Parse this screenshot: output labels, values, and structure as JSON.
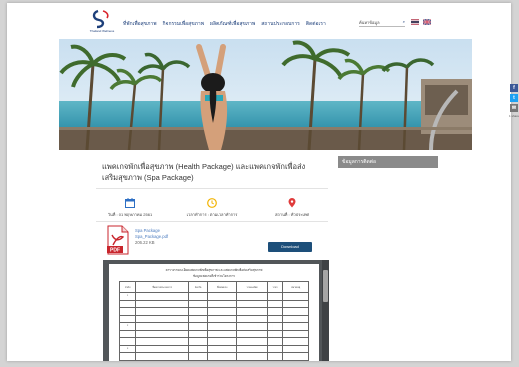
{
  "header": {
    "logo_text": "Thailand Wellness",
    "nav": [
      "ที่พักเพื่อสุขภาพ",
      "กิจกรรมเพื่อสุขภาพ",
      "ผลิตภัณฑ์เพื่อสุขภาพ",
      "สถานประกอบการ",
      "ติดต่อเรา"
    ],
    "search_placeholder": "ค้นหาข้อมูล",
    "flags": [
      "thai-flag-icon",
      "uk-flag-icon"
    ]
  },
  "article": {
    "title": "แพคเกจพักเพื่อสุขภาพ (Health Package) และแพคเกจพักเพื่อส่งเสริมสุขภาพ (Spa Package)",
    "date_label": "วันที่ : 01 พฤษภาคม 2561",
    "hours_label": "เวลาทำการ : ตามเวลาทำการ",
    "location_label": "สถานที่ : ทั่วประเทศ",
    "file": {
      "name": "Spa Package",
      "filename": "Spa_Package.pdf",
      "size": "206.22 KB",
      "download_label": "Download",
      "icon_text": "PDF"
    }
  },
  "sidebar": {
    "heading": "ข้อมูลการติดต่อ"
  },
  "document": {
    "heading_line1": "ตารางรายละเอียดแพคเกจพักเพื่อสุขภาพ และแพคเกจพักเพื่อส่งเสริมสุขภาพ",
    "heading_line2": "ข้อมูลแพคเกจที่เข้าร่วมโครงการ",
    "columns": [
      "ลำดับ",
      "ชื่อสถานประกอบการ",
      "จังหวัด",
      "ชื่อแพคเกจ",
      "รายละเอียด",
      "ราคา",
      "หมายเหตุ"
    ],
    "rows": [
      [
        "1",
        "",
        "",
        "",
        "",
        "",
        ""
      ],
      [
        "",
        "",
        "",
        "",
        "",
        "",
        ""
      ],
      [
        "",
        "",
        "",
        "",
        "",
        "",
        ""
      ],
      [
        "",
        "",
        "",
        "",
        "",
        "",
        ""
      ],
      [
        "2",
        "",
        "",
        "",
        "",
        "",
        ""
      ],
      [
        "",
        "",
        "",
        "",
        "",
        "",
        ""
      ],
      [
        "",
        "",
        "",
        "",
        "",
        "",
        ""
      ],
      [
        "3",
        "",
        "",
        "",
        "",
        "",
        ""
      ],
      [
        "",
        "",
        "",
        "",
        "",
        "",
        ""
      ],
      [
        "",
        "",
        "",
        "",
        "",
        "",
        ""
      ]
    ]
  },
  "social": {
    "facebook": "f",
    "twitter": "t",
    "email": "✉",
    "share_count": "1 share"
  },
  "colors": {
    "navy": "#1d3f7a",
    "button": "#1d4f7a",
    "sidebar_head": "#8a8a8a",
    "date_icon": "#2d6fc4",
    "clock_icon": "#f2b300",
    "pin_icon": "#e03b3b",
    "pdf_red": "#c8252c"
  }
}
